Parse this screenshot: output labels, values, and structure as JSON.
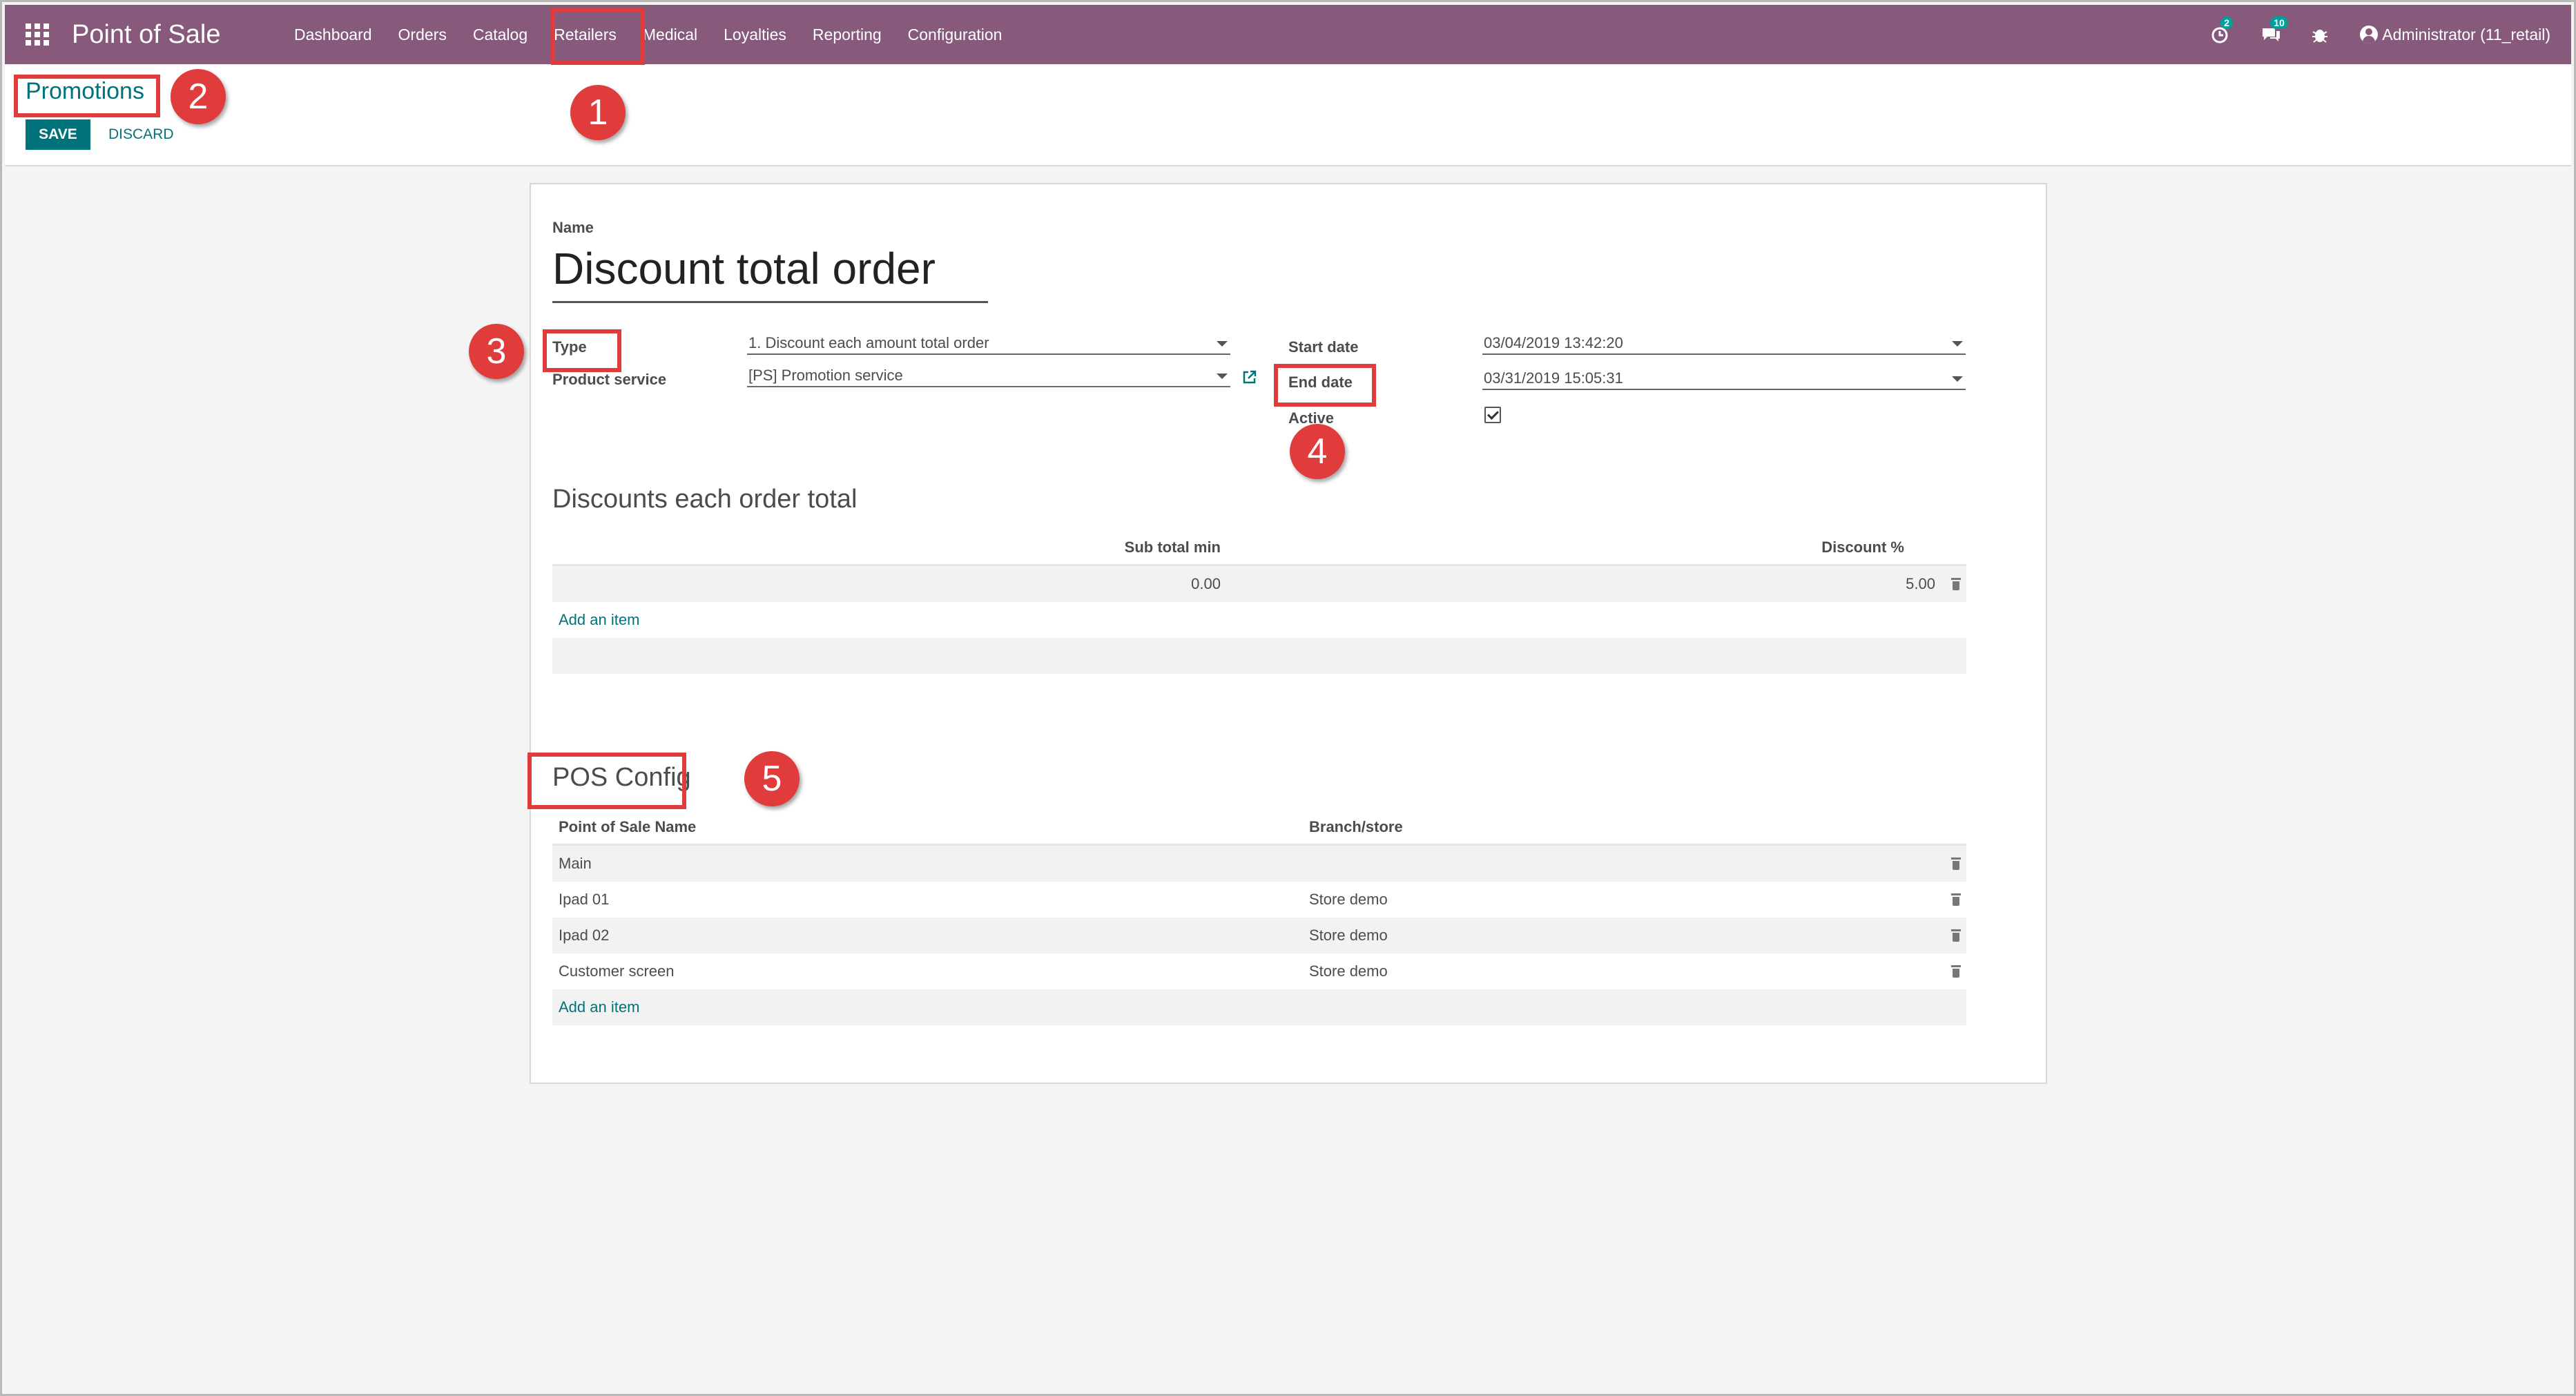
{
  "navbar": {
    "app_title": "Point of Sale",
    "menu": [
      "Dashboard",
      "Orders",
      "Catalog",
      "Retailers",
      "Medical",
      "Loyalties",
      "Reporting",
      "Configuration"
    ],
    "activity_badge": "2",
    "messages_badge": "10",
    "user": "Administrator (11_retail)",
    "color": "#875a7b"
  },
  "control_panel": {
    "breadcrumb": "Promotions",
    "save_label": "SAVE",
    "discard_label": "DISCARD"
  },
  "form": {
    "name_label": "Name",
    "name_value": "Discount total order",
    "type_label": "Type",
    "type_value": "1. Discount each amount total order",
    "product_service_label": "Product service",
    "product_service_value": "[PS] Promotion service",
    "start_date_label": "Start date",
    "start_date_value": "03/04/2019 13:42:20",
    "end_date_label": "End date",
    "end_date_value": "03/31/2019 15:05:31",
    "active_label": "Active",
    "active_checked": true
  },
  "discounts": {
    "title": "Discounts each order total",
    "columns": [
      "Sub total min",
      "Discount %"
    ],
    "rows": [
      {
        "subtotal_min": "0.00",
        "discount": "5.00"
      }
    ],
    "add_item": "Add an item"
  },
  "pos_config": {
    "title": "POS Config",
    "columns": [
      "Point of Sale Name",
      "Branch/store"
    ],
    "rows": [
      {
        "name": "Main",
        "branch": ""
      },
      {
        "name": "Ipad 01",
        "branch": "Store demo"
      },
      {
        "name": "Ipad 02",
        "branch": "Store demo"
      },
      {
        "name": "Customer screen",
        "branch": "Store demo"
      }
    ],
    "add_item": "Add an item"
  },
  "annotations": [
    "1",
    "2",
    "3",
    "4",
    "5"
  ],
  "annotation_color": "#e03c3c",
  "accent_color": "#00737a"
}
